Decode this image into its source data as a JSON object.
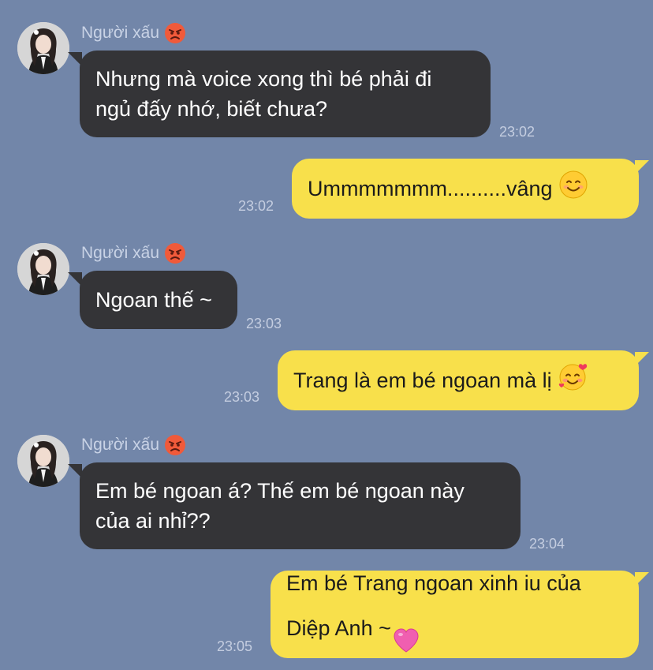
{
  "contact": {
    "name": "Người xấu",
    "name_icon": "angry-face-icon"
  },
  "messages": [
    {
      "direction": "in",
      "text": "Nhưng mà voice xong thì bé phải đi\nngủ đấy nhớ, biết chưa?",
      "time": "23:02"
    },
    {
      "direction": "out",
      "text": "Ummmmmmm..........vâng",
      "emoji": "smiling-face-icon",
      "time": "23:02"
    },
    {
      "direction": "in",
      "text": "Ngoan thế ~",
      "time": "23:03"
    },
    {
      "direction": "out",
      "text": "Trang là em bé ngoan mà lị",
      "emoji": "smiling-face-with-hearts-icon",
      "time": "23:03"
    },
    {
      "direction": "in",
      "text": "Em bé ngoan á? Thế em bé ngoan này\ncủa ai nhỉ??",
      "time": "23:04"
    },
    {
      "direction": "out",
      "text": "Em bé Trang ngoan xinh iu của\nDiệp Anh ~",
      "emoji": "pink-heart-icon",
      "time": "23:05"
    }
  ],
  "colors": {
    "background": "#7286a9",
    "incoming_bubble": "#343437",
    "outgoing_bubble": "#f8e04b",
    "meta_text": "#c9d3e6"
  }
}
